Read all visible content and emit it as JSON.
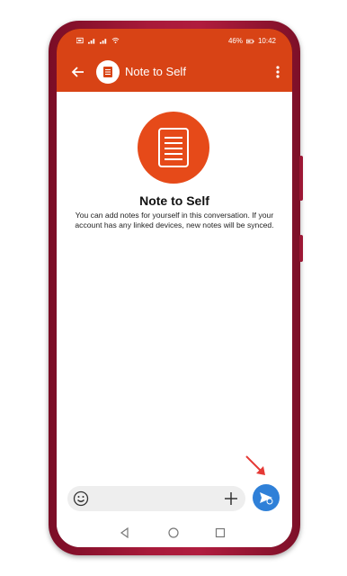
{
  "status_bar": {
    "battery": "46%",
    "time": "10:42"
  },
  "app_bar": {
    "title": "Note to Self",
    "back_icon": "arrow-left-icon",
    "menu_icon": "more-vert-icon",
    "color": "#d84315"
  },
  "hero": {
    "title": "Note to Self",
    "description": "You can add notes for yourself in this conversation. If your account has any linked devices, new notes will be synced.",
    "icon": "note-icon",
    "color": "#e64a19"
  },
  "composer": {
    "value": "",
    "emoji_icon": "emoji-icon",
    "add_icon": "plus-icon",
    "send_icon": "send-icon",
    "send_color": "#2f80d8"
  },
  "nav": {
    "back_icon": "nav-back-icon",
    "home_icon": "nav-home-icon",
    "recent_icon": "nav-recent-icon"
  }
}
